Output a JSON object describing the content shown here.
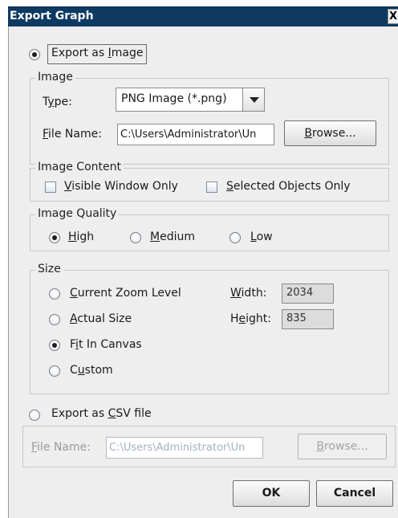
{
  "window": {
    "title": "Export Graph",
    "close_glyph": "X"
  },
  "export_image": {
    "label_pre": "Export as ",
    "label_mnemonic": "I",
    "label_post": "mage",
    "selected": true
  },
  "image_group": {
    "title": "Image",
    "type_label_pre": "T",
    "type_label_mnemonic": "y",
    "type_label_post": "pe:",
    "type_value": "PNG Image (*.png)",
    "file_label_mnemonic": "F",
    "file_label_post": "ile Name:",
    "file_value": "C:\\Users\\Administrator\\Un",
    "browse_mnemonic": "B",
    "browse_post": "rowse..."
  },
  "content_group": {
    "title": "Image Content",
    "visible_mnemonic": "V",
    "visible_post": "isible Window Only",
    "visible_checked": false,
    "selected_mnemonic": "S",
    "selected_post": "elected Objects Only",
    "selected_checked": false
  },
  "quality_group": {
    "title": "Image Quality",
    "high_mnemonic": "H",
    "high_post": "igh",
    "medium_mnemonic": "M",
    "medium_post": "edium",
    "low_mnemonic": "L",
    "low_post": "ow",
    "selected": "High"
  },
  "size_group": {
    "title": "Size",
    "current_mnemonic": "C",
    "current_post": "urrent Zoom Level",
    "actual_mnemonic": "A",
    "actual_post": "ctual Size",
    "fit_pre": "F",
    "fit_mnemonic": "i",
    "fit_post": "t In Canvas",
    "custom_pre": "C",
    "custom_mnemonic": "u",
    "custom_post": "stom",
    "selected": "Fit In Canvas",
    "width_mnemonic": "W",
    "width_post": "idth:",
    "width_value": "2034",
    "height_pre": "H",
    "height_mnemonic": "e",
    "height_post": "ight:",
    "height_value": "835"
  },
  "export_csv": {
    "label_pre": "Export as ",
    "label_mnemonic": "C",
    "label_post": "SV file",
    "selected": false,
    "file_label_mnemonic": "F",
    "file_label_post": "ile Name:",
    "file_value": "C:\\Users\\Administrator\\Un",
    "browse_mnemonic": "B",
    "browse_post": "rowse..."
  },
  "footer": {
    "ok_label": "OK",
    "cancel_label": "Cancel"
  }
}
